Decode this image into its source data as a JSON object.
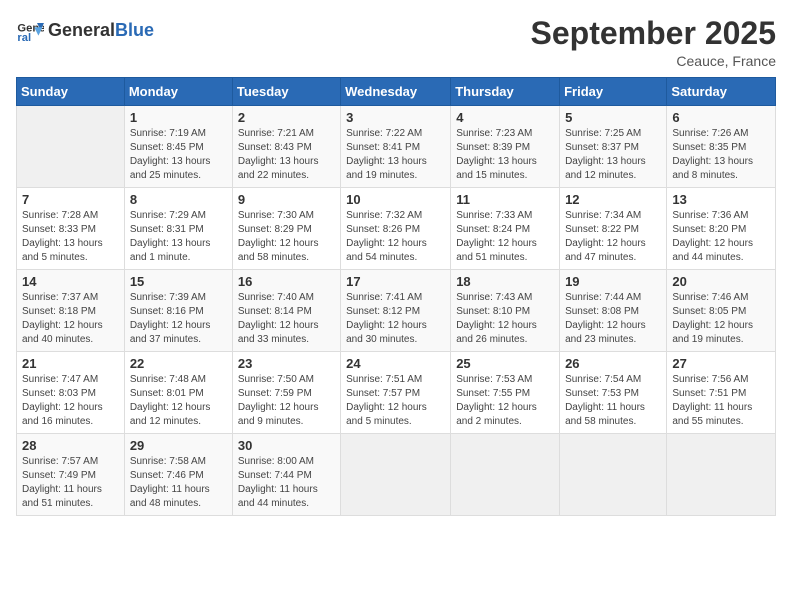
{
  "logo": {
    "general": "General",
    "blue": "Blue"
  },
  "title": "September 2025",
  "subtitle": "Ceauce, France",
  "days_of_week": [
    "Sunday",
    "Monday",
    "Tuesday",
    "Wednesday",
    "Thursday",
    "Friday",
    "Saturday"
  ],
  "weeks": [
    [
      {
        "day": "",
        "info": ""
      },
      {
        "day": "1",
        "info": "Sunrise: 7:19 AM\nSunset: 8:45 PM\nDaylight: 13 hours and 25 minutes."
      },
      {
        "day": "2",
        "info": "Sunrise: 7:21 AM\nSunset: 8:43 PM\nDaylight: 13 hours and 22 minutes."
      },
      {
        "day": "3",
        "info": "Sunrise: 7:22 AM\nSunset: 8:41 PM\nDaylight: 13 hours and 19 minutes."
      },
      {
        "day": "4",
        "info": "Sunrise: 7:23 AM\nSunset: 8:39 PM\nDaylight: 13 hours and 15 minutes."
      },
      {
        "day": "5",
        "info": "Sunrise: 7:25 AM\nSunset: 8:37 PM\nDaylight: 13 hours and 12 minutes."
      },
      {
        "day": "6",
        "info": "Sunrise: 7:26 AM\nSunset: 8:35 PM\nDaylight: 13 hours and 8 minutes."
      }
    ],
    [
      {
        "day": "7",
        "info": "Sunrise: 7:28 AM\nSunset: 8:33 PM\nDaylight: 13 hours and 5 minutes."
      },
      {
        "day": "8",
        "info": "Sunrise: 7:29 AM\nSunset: 8:31 PM\nDaylight: 13 hours and 1 minute."
      },
      {
        "day": "9",
        "info": "Sunrise: 7:30 AM\nSunset: 8:29 PM\nDaylight: 12 hours and 58 minutes."
      },
      {
        "day": "10",
        "info": "Sunrise: 7:32 AM\nSunset: 8:26 PM\nDaylight: 12 hours and 54 minutes."
      },
      {
        "day": "11",
        "info": "Sunrise: 7:33 AM\nSunset: 8:24 PM\nDaylight: 12 hours and 51 minutes."
      },
      {
        "day": "12",
        "info": "Sunrise: 7:34 AM\nSunset: 8:22 PM\nDaylight: 12 hours and 47 minutes."
      },
      {
        "day": "13",
        "info": "Sunrise: 7:36 AM\nSunset: 8:20 PM\nDaylight: 12 hours and 44 minutes."
      }
    ],
    [
      {
        "day": "14",
        "info": "Sunrise: 7:37 AM\nSunset: 8:18 PM\nDaylight: 12 hours and 40 minutes."
      },
      {
        "day": "15",
        "info": "Sunrise: 7:39 AM\nSunset: 8:16 PM\nDaylight: 12 hours and 37 minutes."
      },
      {
        "day": "16",
        "info": "Sunrise: 7:40 AM\nSunset: 8:14 PM\nDaylight: 12 hours and 33 minutes."
      },
      {
        "day": "17",
        "info": "Sunrise: 7:41 AM\nSunset: 8:12 PM\nDaylight: 12 hours and 30 minutes."
      },
      {
        "day": "18",
        "info": "Sunrise: 7:43 AM\nSunset: 8:10 PM\nDaylight: 12 hours and 26 minutes."
      },
      {
        "day": "19",
        "info": "Sunrise: 7:44 AM\nSunset: 8:08 PM\nDaylight: 12 hours and 23 minutes."
      },
      {
        "day": "20",
        "info": "Sunrise: 7:46 AM\nSunset: 8:05 PM\nDaylight: 12 hours and 19 minutes."
      }
    ],
    [
      {
        "day": "21",
        "info": "Sunrise: 7:47 AM\nSunset: 8:03 PM\nDaylight: 12 hours and 16 minutes."
      },
      {
        "day": "22",
        "info": "Sunrise: 7:48 AM\nSunset: 8:01 PM\nDaylight: 12 hours and 12 minutes."
      },
      {
        "day": "23",
        "info": "Sunrise: 7:50 AM\nSunset: 7:59 PM\nDaylight: 12 hours and 9 minutes."
      },
      {
        "day": "24",
        "info": "Sunrise: 7:51 AM\nSunset: 7:57 PM\nDaylight: 12 hours and 5 minutes."
      },
      {
        "day": "25",
        "info": "Sunrise: 7:53 AM\nSunset: 7:55 PM\nDaylight: 12 hours and 2 minutes."
      },
      {
        "day": "26",
        "info": "Sunrise: 7:54 AM\nSunset: 7:53 PM\nDaylight: 11 hours and 58 minutes."
      },
      {
        "day": "27",
        "info": "Sunrise: 7:56 AM\nSunset: 7:51 PM\nDaylight: 11 hours and 55 minutes."
      }
    ],
    [
      {
        "day": "28",
        "info": "Sunrise: 7:57 AM\nSunset: 7:49 PM\nDaylight: 11 hours and 51 minutes."
      },
      {
        "day": "29",
        "info": "Sunrise: 7:58 AM\nSunset: 7:46 PM\nDaylight: 11 hours and 48 minutes."
      },
      {
        "day": "30",
        "info": "Sunrise: 8:00 AM\nSunset: 7:44 PM\nDaylight: 11 hours and 44 minutes."
      },
      {
        "day": "",
        "info": ""
      },
      {
        "day": "",
        "info": ""
      },
      {
        "day": "",
        "info": ""
      },
      {
        "day": "",
        "info": ""
      }
    ]
  ]
}
